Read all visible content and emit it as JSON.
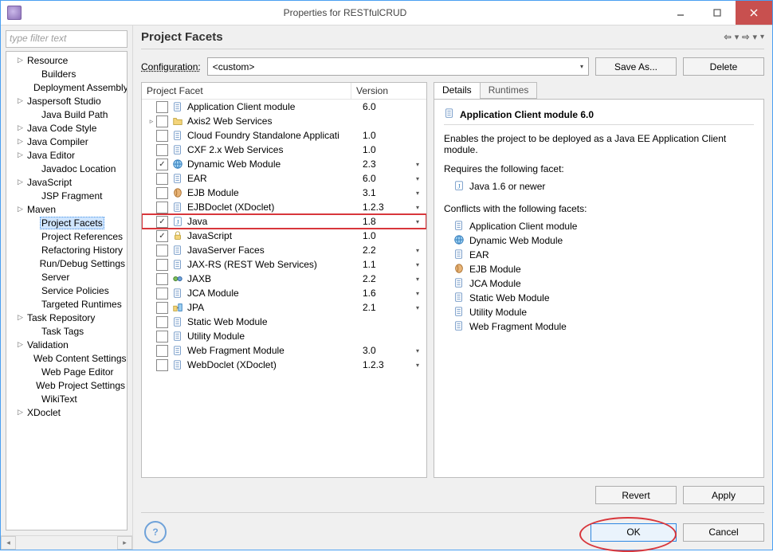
{
  "window": {
    "title": "Properties for RESTfulCRUD"
  },
  "filter": {
    "placeholder": "type filter text"
  },
  "tree": [
    {
      "label": "Resource",
      "level": 1,
      "expandable": true
    },
    {
      "label": "Builders",
      "level": 2
    },
    {
      "label": "Deployment Assembly",
      "level": 2
    },
    {
      "label": "Jaspersoft Studio",
      "level": 1,
      "expandable": true
    },
    {
      "label": "Java Build Path",
      "level": 2
    },
    {
      "label": "Java Code Style",
      "level": 1,
      "expandable": true
    },
    {
      "label": "Java Compiler",
      "level": 1,
      "expandable": true
    },
    {
      "label": "Java Editor",
      "level": 1,
      "expandable": true
    },
    {
      "label": "Javadoc Location",
      "level": 2
    },
    {
      "label": "JavaScript",
      "level": 1,
      "expandable": true
    },
    {
      "label": "JSP Fragment",
      "level": 2
    },
    {
      "label": "Maven",
      "level": 1,
      "expandable": true
    },
    {
      "label": "Project Facets",
      "level": 2,
      "selected": true
    },
    {
      "label": "Project References",
      "level": 2
    },
    {
      "label": "Refactoring History",
      "level": 2
    },
    {
      "label": "Run/Debug Settings",
      "level": 2
    },
    {
      "label": "Server",
      "level": 2
    },
    {
      "label": "Service Policies",
      "level": 2
    },
    {
      "label": "Targeted Runtimes",
      "level": 2
    },
    {
      "label": "Task Repository",
      "level": 1,
      "expandable": true
    },
    {
      "label": "Task Tags",
      "level": 2
    },
    {
      "label": "Validation",
      "level": 1,
      "expandable": true
    },
    {
      "label": "Web Content Settings",
      "level": 2
    },
    {
      "label": "Web Page Editor",
      "level": 2
    },
    {
      "label": "Web Project Settings",
      "level": 2
    },
    {
      "label": "WikiText",
      "level": 2
    },
    {
      "label": "XDoclet",
      "level": 1,
      "expandable": true
    }
  ],
  "page": {
    "heading": "Project Facets",
    "config_label": "Configuration:",
    "config_value": "<custom>",
    "saveas": "Save As...",
    "delete": "Delete",
    "revert": "Revert",
    "apply": "Apply",
    "ok": "OK",
    "cancel": "Cancel"
  },
  "facet_table": {
    "col_facet": "Project Facet",
    "col_version": "Version",
    "rows": [
      {
        "name": "Application Client module",
        "version": "6.0",
        "checked": false,
        "icon": "doc",
        "dd": false,
        "expand": ""
      },
      {
        "name": "Axis2 Web Services",
        "version": "",
        "checked": false,
        "icon": "folder",
        "dd": false,
        "expand": "▹"
      },
      {
        "name": "Cloud Foundry Standalone Applicati",
        "version": "1.0",
        "checked": false,
        "icon": "doc",
        "dd": false,
        "expand": ""
      },
      {
        "name": "CXF 2.x Web Services",
        "version": "1.0",
        "checked": false,
        "icon": "doc",
        "dd": false,
        "expand": ""
      },
      {
        "name": "Dynamic Web Module",
        "version": "2.3",
        "checked": true,
        "icon": "globe",
        "dd": true,
        "expand": ""
      },
      {
        "name": "EAR",
        "version": "6.0",
        "checked": false,
        "icon": "doc",
        "dd": true,
        "expand": ""
      },
      {
        "name": "EJB Module",
        "version": "3.1",
        "checked": false,
        "icon": "bean",
        "dd": true,
        "expand": ""
      },
      {
        "name": "EJBDoclet (XDoclet)",
        "version": "1.2.3",
        "checked": false,
        "icon": "doc",
        "dd": true,
        "expand": ""
      },
      {
        "name": "Java",
        "version": "1.8",
        "checked": true,
        "icon": "java",
        "dd": true,
        "expand": "",
        "highlight": true
      },
      {
        "name": "JavaScript",
        "version": "1.0",
        "checked": true,
        "icon": "lock",
        "dd": false,
        "expand": ""
      },
      {
        "name": "JavaServer Faces",
        "version": "2.2",
        "checked": false,
        "icon": "doc",
        "dd": true,
        "expand": ""
      },
      {
        "name": "JAX-RS (REST Web Services)",
        "version": "1.1",
        "checked": false,
        "icon": "doc",
        "dd": true,
        "expand": ""
      },
      {
        "name": "JAXB",
        "version": "2.2",
        "checked": false,
        "icon": "jaxb",
        "dd": true,
        "expand": ""
      },
      {
        "name": "JCA Module",
        "version": "1.6",
        "checked": false,
        "icon": "doc",
        "dd": true,
        "expand": ""
      },
      {
        "name": "JPA",
        "version": "2.1",
        "checked": false,
        "icon": "jpa",
        "dd": true,
        "expand": ""
      },
      {
        "name": "Static Web Module",
        "version": "",
        "checked": false,
        "icon": "doc",
        "dd": false,
        "expand": ""
      },
      {
        "name": "Utility Module",
        "version": "",
        "checked": false,
        "icon": "doc",
        "dd": false,
        "expand": ""
      },
      {
        "name": "Web Fragment Module",
        "version": "3.0",
        "checked": false,
        "icon": "doc",
        "dd": true,
        "expand": ""
      },
      {
        "name": "WebDoclet (XDoclet)",
        "version": "1.2.3",
        "checked": false,
        "icon": "doc",
        "dd": true,
        "expand": ""
      }
    ]
  },
  "details": {
    "tab_details": "Details",
    "tab_runtimes": "Runtimes",
    "title": "Application Client module 6.0",
    "description": "Enables the project to be deployed as a Java EE Application Client module.",
    "requires_label": "Requires the following facet:",
    "requires": [
      {
        "icon": "java",
        "label": "Java 1.6 or newer"
      }
    ],
    "conflicts_label": "Conflicts with the following facets:",
    "conflicts": [
      {
        "icon": "doc",
        "label": "Application Client module"
      },
      {
        "icon": "globe",
        "label": "Dynamic Web Module"
      },
      {
        "icon": "doc",
        "label": "EAR"
      },
      {
        "icon": "bean",
        "label": "EJB Module"
      },
      {
        "icon": "doc",
        "label": "JCA Module"
      },
      {
        "icon": "doc",
        "label": "Static Web Module"
      },
      {
        "icon": "doc",
        "label": "Utility Module"
      },
      {
        "icon": "doc",
        "label": "Web Fragment Module"
      }
    ]
  }
}
